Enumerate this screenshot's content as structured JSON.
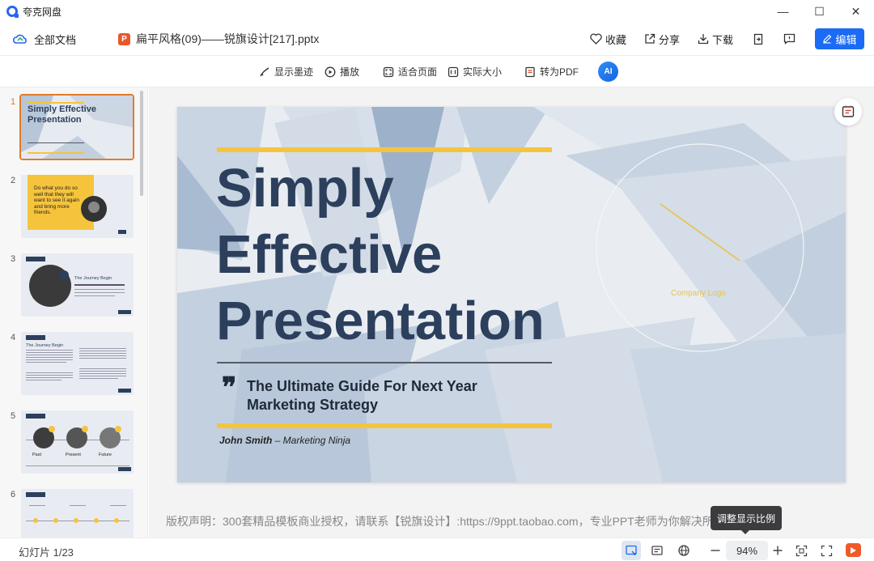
{
  "app": {
    "title": "夸克网盘"
  },
  "window": {
    "minimize": "—",
    "maximize": "☐",
    "close": "✕"
  },
  "header": {
    "all_docs": "全部文档",
    "file_badge": "P",
    "file_name": "扁平风格(09)——锐旗设计[217].pptx",
    "favorite": "收藏",
    "share": "分享",
    "download": "下载",
    "edit": "编辑"
  },
  "toolbar": {
    "show_ink": "显示墨迹",
    "play": "播放",
    "fit_page": "适合页面",
    "actual_size": "实际大小",
    "to_pdf": "转为PDF",
    "ai": "AI"
  },
  "sidebar": {
    "thumbnails": [
      {
        "num": "1",
        "title": "Simply Effective Presentation"
      },
      {
        "num": "2",
        "quote": "Do what you do so well that they will want to see it again and bring more friends."
      },
      {
        "num": "3",
        "label": "The Journey Begin"
      },
      {
        "num": "4",
        "label": "The Journey Begin"
      },
      {
        "num": "5",
        "labels": [
          "Past",
          "Present",
          "Future"
        ]
      },
      {
        "num": "6"
      }
    ]
  },
  "slide": {
    "title_line1": "Simply",
    "title_line2": "Effective",
    "title_line3": "Presentation",
    "quote_mark": "❞",
    "subtitle_line1": "The Ultimate Guide For Next Year",
    "subtitle_line2": "Marketing Strategy",
    "author_name": "John Smith",
    "author_role": " – Marketing Ninja",
    "logo_text": "Company Logo"
  },
  "copyright": "版权声明：300套精品模板商业授权，请联系【锐旗设计】:https://9ppt.taobao.com，专业PPT老师为你解决所有PPT问题",
  "tooltip": "调整显示比例",
  "status": {
    "slide_counter": "幻灯片 1/23",
    "zoom": "94%"
  },
  "colors": {
    "accent": "#1b6bf5",
    "slide_yellow": "#f6c43c",
    "slide_navy": "#2c3f5c",
    "active_thumb": "#e07b2a"
  }
}
